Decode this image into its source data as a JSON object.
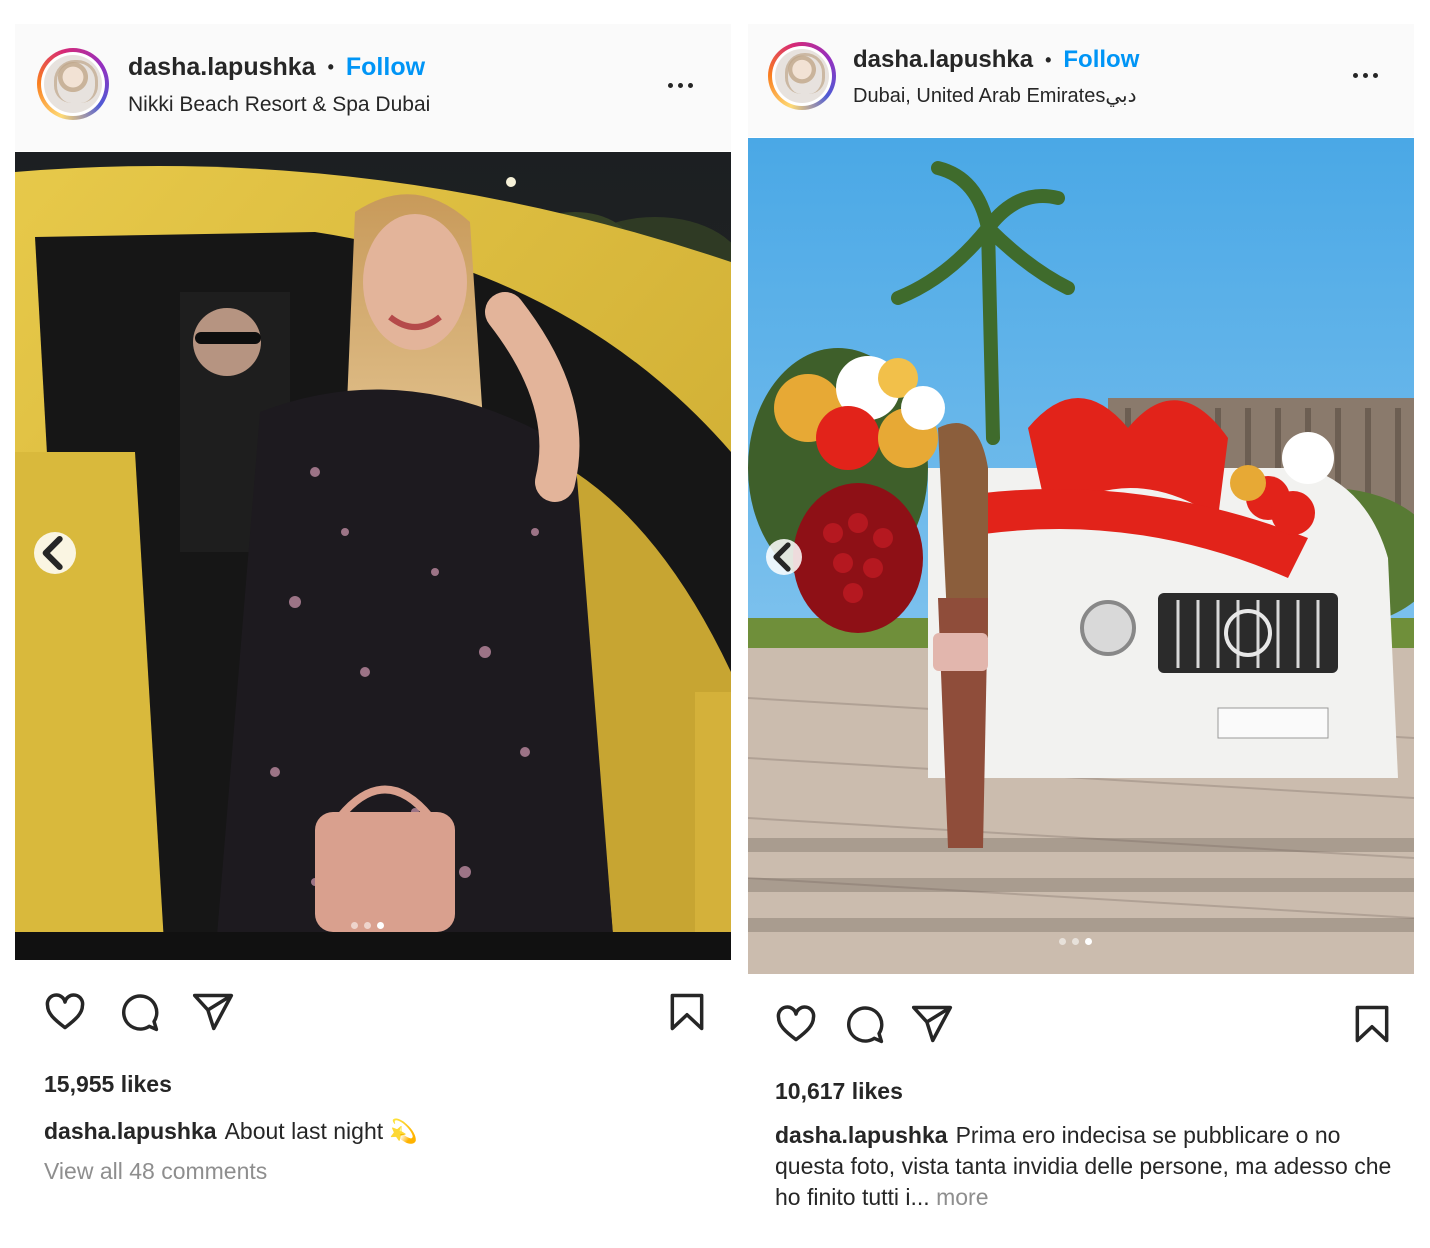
{
  "posts": [
    {
      "username": "dasha.lapushka",
      "follow_label": "Follow",
      "separator": "•",
      "location": "Nikki Beach Resort & Spa Dubai",
      "likes": "15,955 likes",
      "caption_user": "dasha.lapushka",
      "caption_text": "About last night",
      "caption_emoji": "💫",
      "comments_link": "View all 48 comments",
      "carousel": {
        "count": 3,
        "active_index": 2
      },
      "photo_icon": "photo-woman-yellow-car"
    },
    {
      "username": "dasha.lapushka",
      "follow_label": "Follow",
      "separator": "•",
      "location": "Dubai, United Arab Emiratesدبي",
      "likes": "10,617 likes",
      "caption_user": "dasha.lapushka",
      "caption_text": "Prima ero indecisa se pubblicare o no questa foto, vista tanta invidia delle persone, ma adesso che ho finito tutti i...",
      "caption_more": "more",
      "carousel": {
        "count": 3,
        "active_index": 2
      },
      "photo_icon": "photo-white-suv-with-bow"
    }
  ],
  "icons": {
    "like": "heart-icon",
    "comment": "comment-bubble-icon",
    "share": "paper-plane-icon",
    "save": "bookmark-icon",
    "more": "more-dots-icon",
    "prev": "chevron-left-icon"
  },
  "colors": {
    "follow": "#0095f6",
    "text": "#262626",
    "muted": "#8e8e8e",
    "header_bg": "#fafafa"
  }
}
